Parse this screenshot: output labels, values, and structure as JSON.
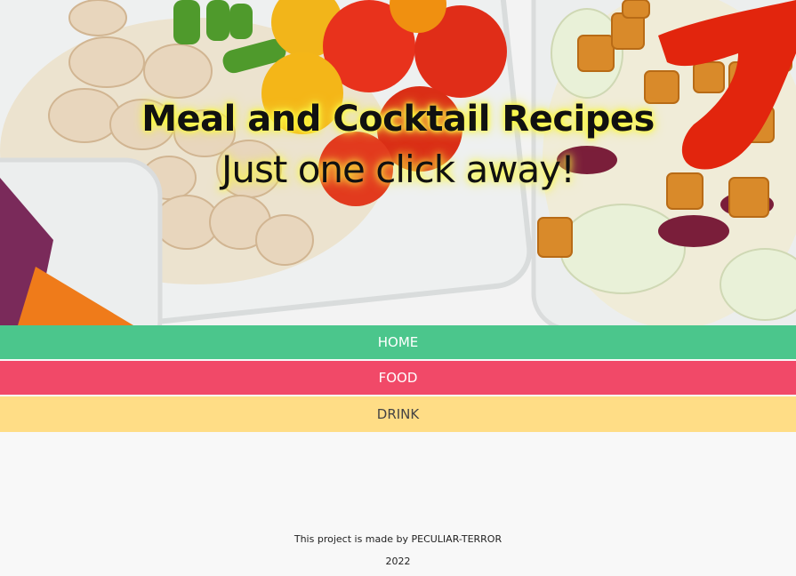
{
  "hero": {
    "title": "Meal and Cocktail Recipes",
    "subtitle": "Just one click away!",
    "background_image": "meal-prep-food-containers"
  },
  "nav": {
    "items": [
      {
        "label": "HOME",
        "color": "#4bc68c"
      },
      {
        "label": "FOOD",
        "color": "#f14968"
      },
      {
        "label": "DRINK",
        "color": "#ffdd86"
      }
    ]
  },
  "footer": {
    "credit": "This project is made by PECULIAR-TERROR",
    "year": "2022"
  }
}
